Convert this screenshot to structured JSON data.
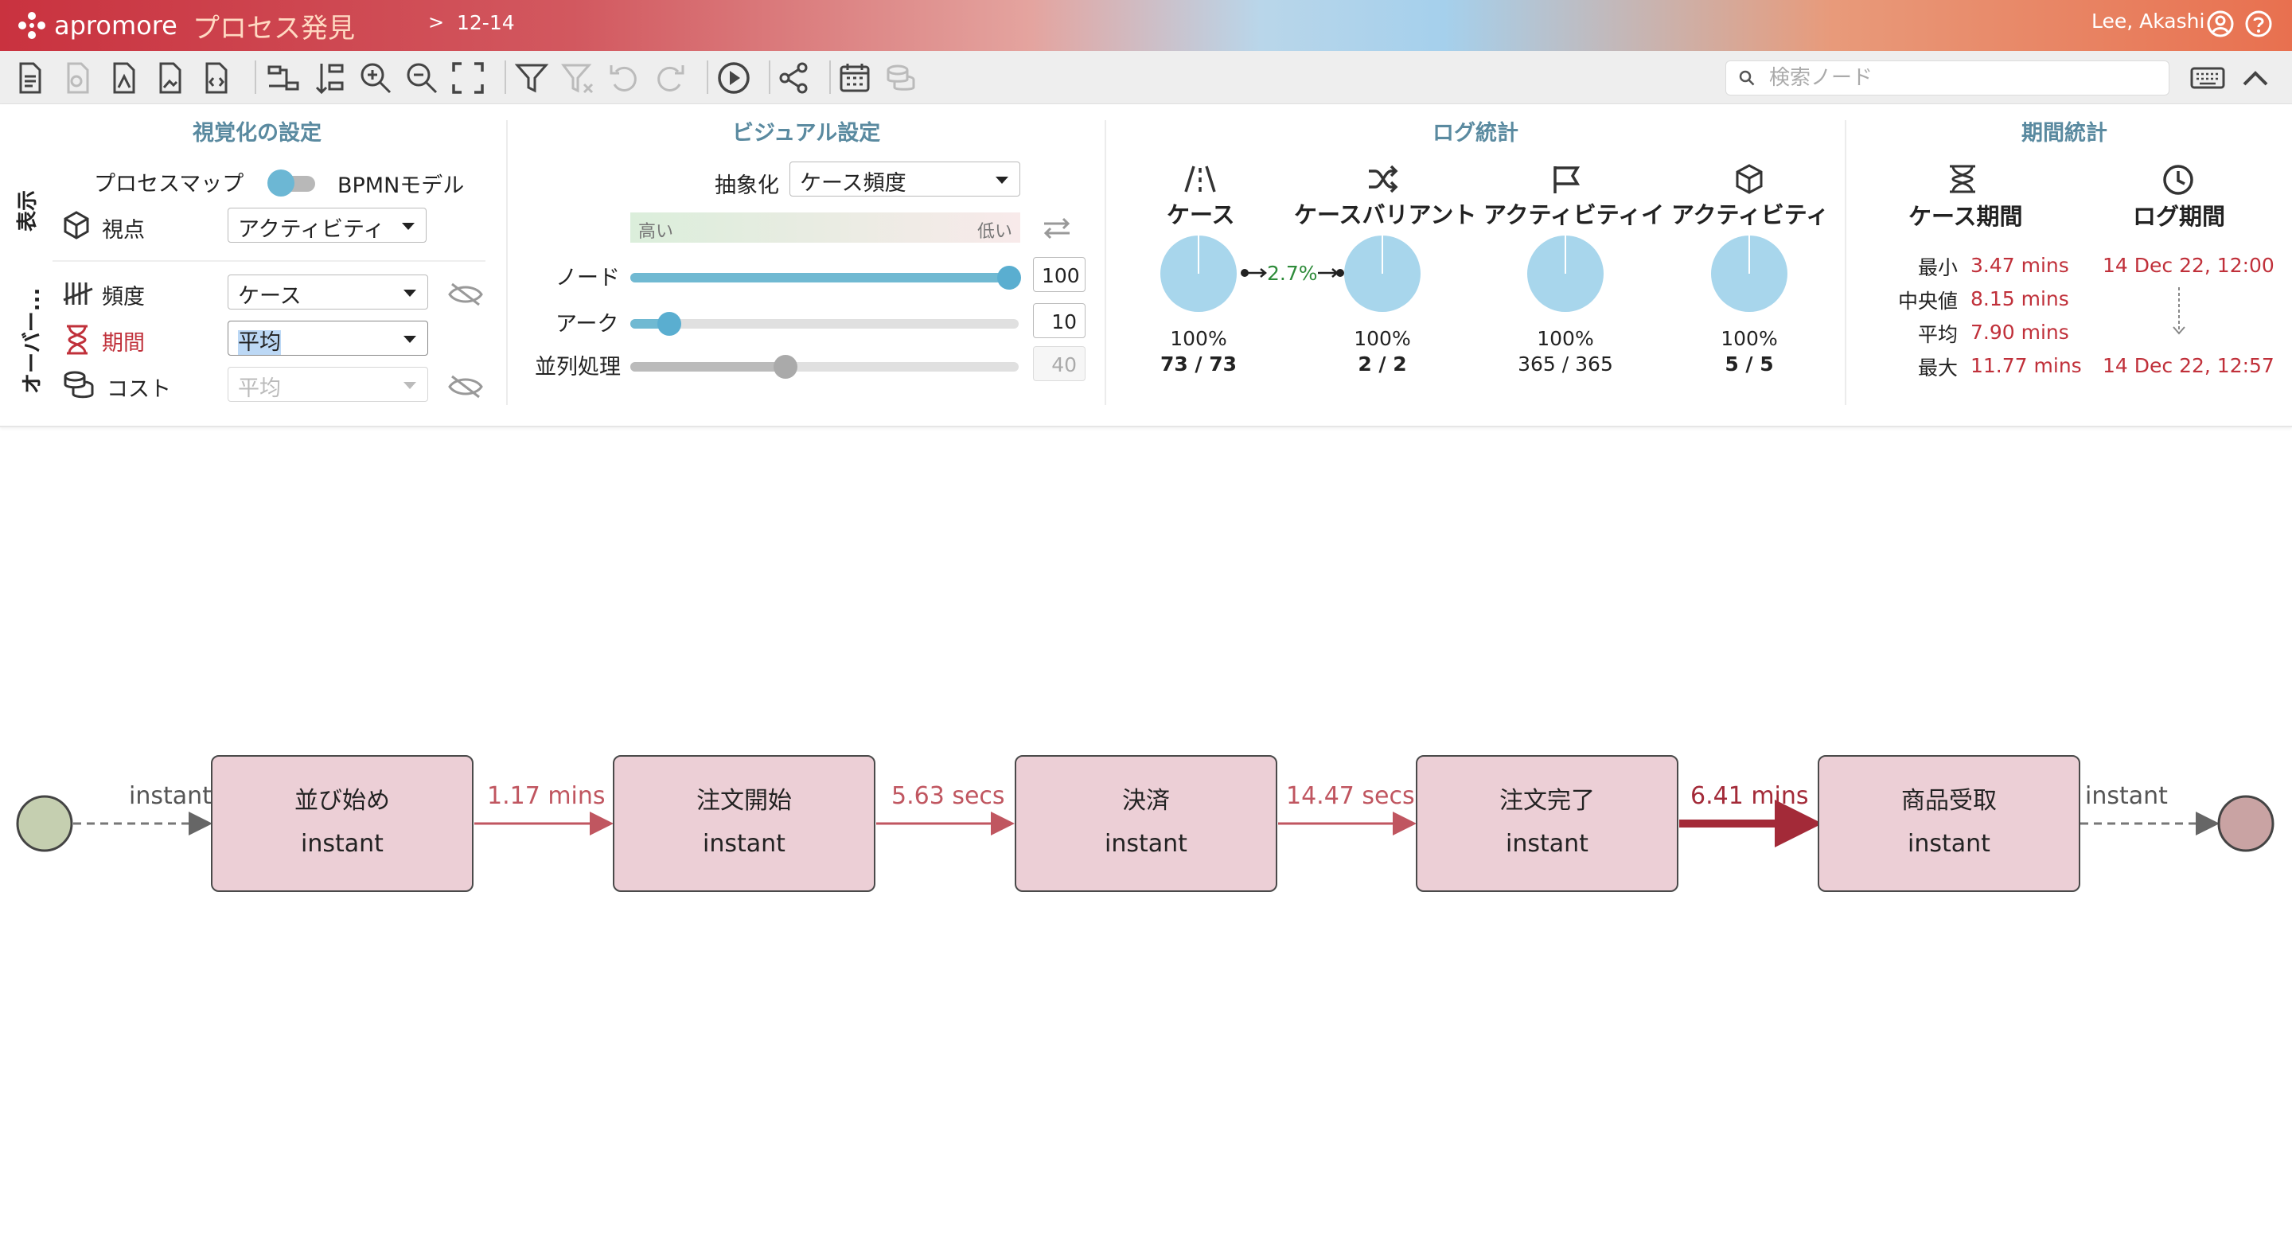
{
  "header": {
    "brand": "apromore",
    "app_title": "プロセス発見",
    "breadcrumb_sep": ">",
    "breadcrumb": "12-14",
    "user_name": "Lee, Akashi"
  },
  "toolbar": {
    "search_placeholder": "検索ノード",
    "icons": [
      "export-bpmn-icon",
      "export-disabled-icon",
      "export-pdf-icon",
      "export-png-icon",
      "export-svg-icon",
      "layout-horizontal-icon",
      "layout-vertical-icon",
      "zoom-in-icon",
      "zoom-out-icon",
      "fit-screen-icon",
      "filter-icon",
      "clear-filter-icon",
      "undo-icon",
      "redo-icon",
      "play-animation-icon",
      "share-icon",
      "calendar-icon",
      "cost-icon",
      "keyboard-icon",
      "collapse-icon"
    ]
  },
  "viz_settings": {
    "title": "視覚化の設定",
    "display_label": "表示",
    "overlay_label": "オーバー...",
    "process_map_label": "プロセスマップ",
    "bpmn_label": "BPMNモデル",
    "perspective_label": "視点",
    "perspective_value": "アクティビティ",
    "frequency_label": "頻度",
    "frequency_value": "ケース",
    "duration_label": "期間",
    "duration_value": "平均",
    "cost_label": "コスト",
    "cost_value": "平均"
  },
  "visual_settings": {
    "title": "ビジュアル設定",
    "abstraction_label": "抽象化",
    "abstraction_value": "ケース頻度",
    "gradient_high": "高い",
    "gradient_low": "低い",
    "node_label": "ノード",
    "node_value": "100",
    "node_level": 100,
    "arc_label": "アーク",
    "arc_value": "10",
    "arc_level": 10,
    "parallel_label": "並列処理",
    "parallel_value": "40",
    "parallel_level": 40
  },
  "log_stats": {
    "title": "ログ統計",
    "variant_ratio": "2.7%",
    "items": [
      {
        "label": "ケース",
        "pct": "100%",
        "count": "73 / 73",
        "icon": "road-icon",
        "bold": true
      },
      {
        "label": "ケースバリアント",
        "pct": "100%",
        "count": "2 / 2",
        "icon": "shuffle-icon",
        "bold": true
      },
      {
        "label": "アクティビティインスタ",
        "pct": "100%",
        "count": "365 / 365",
        "icon": "flag-icon",
        "bold": false
      },
      {
        "label": "アクティビティ",
        "pct": "100%",
        "count": "5 / 5",
        "icon": "cube-icon",
        "bold": true
      }
    ]
  },
  "period_stats": {
    "title": "期間統計",
    "case_duration_label": "ケース期間",
    "log_period_label": "ログ期間",
    "rows": [
      {
        "label": "最小",
        "value": "3.47 mins"
      },
      {
        "label": "中央値",
        "value": "8.15 mins"
      },
      {
        "label": "平均",
        "value": "7.90 mins"
      },
      {
        "label": "最大",
        "value": "11.77 mins"
      }
    ],
    "log_start": "14 Dec 22, 12:00",
    "log_end": "14 Dec 22, 12:57"
  },
  "process_map": {
    "start_label": "instant",
    "end_label": "instant",
    "nodes": [
      {
        "name": "並び始め",
        "duration": "instant"
      },
      {
        "name": "注文開始",
        "duration": "instant"
      },
      {
        "name": "決済",
        "duration": "instant"
      },
      {
        "name": "注文完了",
        "duration": "instant"
      },
      {
        "name": "商品受取",
        "duration": "instant"
      }
    ],
    "arcs": [
      "1.17 mins",
      "5.63 secs",
      "14.47 secs",
      "6.41 mins"
    ]
  },
  "colors": {
    "accent": "#5a8aa0",
    "node_fill": "#eccfd6",
    "arc_red": "#c05660",
    "arc_dark": "#a32a38",
    "pie": "#a8d6ec",
    "start_node": "#c5cfb0",
    "end_node": "#c9a3a3"
  }
}
